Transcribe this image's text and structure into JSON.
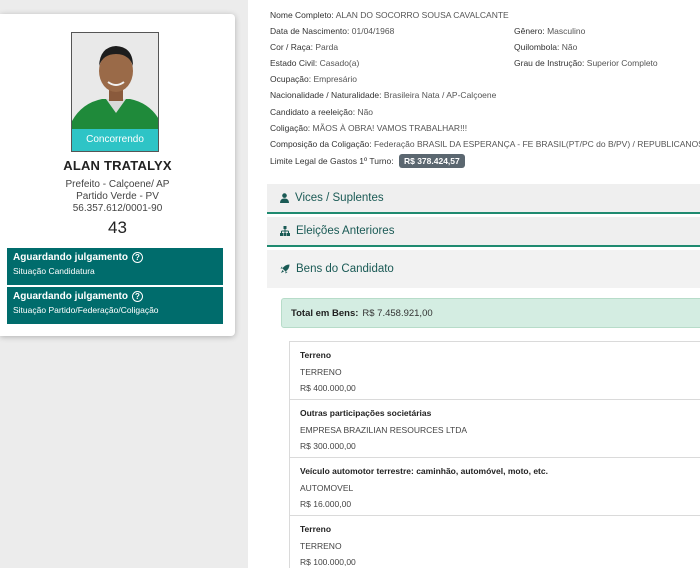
{
  "profile": {
    "photo_badge": "Concorrendo",
    "name": "ALAN TRATALYX",
    "office": "Prefeito - Calçoene/ AP",
    "party": "Partido Verde - PV",
    "cnpj": "56.357.612/0001-90",
    "number": "43",
    "status": [
      {
        "title": "Aguardando julgamento",
        "subtitle": "Situação Candidatura"
      },
      {
        "title": "Aguardando julgamento",
        "subtitle": "Situação Partido/Federação/Coligação"
      }
    ]
  },
  "details": {
    "nome_completo": {
      "label": "Nome Completo:",
      "value": "ALAN DO SOCORRO SOUSA CAVALCANTE"
    },
    "data_nascimento": {
      "label": "Data de Nascimento:",
      "value": "01/04/1968"
    },
    "genero": {
      "label": "Gênero:",
      "value": "Masculino"
    },
    "cor_raca": {
      "label": "Cor / Raça:",
      "value": "Parda"
    },
    "quilombola": {
      "label": "Quilombola:",
      "value": "Não"
    },
    "estado_civil": {
      "label": "Estado Civil:",
      "value": "Casado(a)"
    },
    "grau_instrucao": {
      "label": "Grau de Instrução:",
      "value": "Superior Completo"
    },
    "ocupacao": {
      "label": "Ocupação:",
      "value": "Empresário"
    },
    "nacionalidade": {
      "label": "Nacionalidade / Naturalidade:",
      "value": "Brasileira Nata / AP-Calçoene"
    },
    "reeleicao": {
      "label": "Candidato a reeleição:",
      "value": "Não"
    },
    "coligacao": {
      "label": "Coligação:",
      "value": "MÃOS À OBRA! VAMOS TRABALHAR!!!"
    },
    "composicao": {
      "label": "Composição da Coligação:",
      "value": "Federação BRASIL DA ESPERANÇA - FE BRASIL(PT/PC do B/PV) / REPUBLICANOS"
    },
    "limite_gastos": {
      "label": "Limite Legal de Gastos 1º Turno:",
      "value": "R$ 378.424,57"
    }
  },
  "sections": {
    "vices": "Vices / Suplentes",
    "eleicoes": "Eleições Anteriores",
    "bens": "Bens do Candidato"
  },
  "bens": {
    "total_label": "Total em Bens:",
    "total_value": "R$ 7.458.921,00",
    "items": [
      {
        "tipo": "Terreno",
        "descricao": "TERRENO",
        "valor": "R$ 400.000,00"
      },
      {
        "tipo": "Outras participações societárias",
        "descricao": "EMPRESA BRAZILIAN RESOURCES LTDA",
        "valor": "R$ 300.000,00"
      },
      {
        "tipo": "Veículo automotor terrestre: caminhão, automóvel, moto, etc.",
        "descricao": "AUTOMOVEL",
        "valor": "R$ 16.000,00"
      },
      {
        "tipo": "Terreno",
        "descricao": "TERRENO",
        "valor": "R$ 100.000,00"
      }
    ]
  },
  "colors": {
    "status_bg": "#006c6c",
    "badge_bg": "#2ec4c6",
    "section_accent": "#1f8a70",
    "total_bg": "#d4ede2"
  }
}
